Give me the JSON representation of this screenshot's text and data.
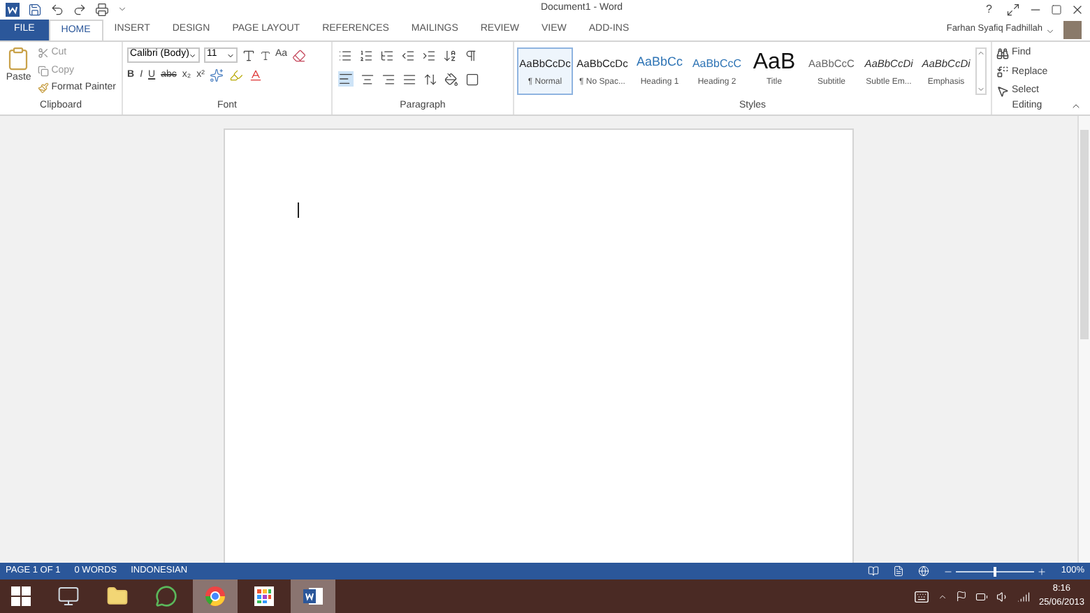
{
  "title_bar": {
    "title": "Document1 - Word",
    "help": "?",
    "user": "Farhan Syafiq Fadhillah"
  },
  "tabs": [
    {
      "label": "FILE",
      "kind": "file",
      "selected": false
    },
    {
      "label": "HOME",
      "kind": "tab",
      "selected": true
    },
    {
      "label": "INSERT",
      "kind": "tab",
      "selected": false
    },
    {
      "label": "DESIGN",
      "kind": "tab",
      "selected": false
    },
    {
      "label": "PAGE LAYOUT",
      "kind": "tab",
      "selected": false
    },
    {
      "label": "REFERENCES",
      "kind": "tab",
      "selected": false
    },
    {
      "label": "MAILINGS",
      "kind": "tab",
      "selected": false
    },
    {
      "label": "REVIEW",
      "kind": "tab",
      "selected": false
    },
    {
      "label": "VIEW",
      "kind": "tab",
      "selected": false
    },
    {
      "label": "ADD-INS",
      "kind": "tab",
      "selected": false
    }
  ],
  "clipboard": {
    "paste": "Paste",
    "cut": "Cut",
    "copy": "Copy",
    "format_painter": "Format Painter",
    "label": "Clipboard"
  },
  "font": {
    "family": "Calibri (Body)",
    "size": "11",
    "change_case": "Aa",
    "format_buttons": [
      "B",
      "I",
      "U",
      "abc",
      "x₂",
      "x²"
    ],
    "label": "Font"
  },
  "paragraph": {
    "label": "Paragraph"
  },
  "styles": {
    "label": "Styles",
    "items": [
      {
        "preview": "AaBbCcDc",
        "name": "¶ Normal",
        "kind": "normal",
        "selected": true
      },
      {
        "preview": "AaBbCcDc",
        "name": "¶ No Spac...",
        "kind": "normal",
        "selected": false
      },
      {
        "preview": "AaBbCc",
        "name": "Heading 1",
        "kind": "heading1",
        "selected": false
      },
      {
        "preview": "AaBbCcC",
        "name": "Heading 2",
        "kind": "heading2",
        "selected": false
      },
      {
        "preview": "AaB",
        "name": "Title",
        "kind": "title",
        "selected": false
      },
      {
        "preview": "AaBbCcC",
        "name": "Subtitle",
        "kind": "subtitle",
        "selected": false
      },
      {
        "preview": "AaBbCcDi",
        "name": "Subtle Em...",
        "kind": "emphasis",
        "selected": false
      },
      {
        "preview": "AaBbCcDi",
        "name": "Emphasis",
        "kind": "emphasis",
        "selected": false
      }
    ]
  },
  "editing": {
    "find": "Find",
    "replace": "Replace",
    "select": "Select",
    "label": "Editing"
  },
  "status_bar": {
    "page": "PAGE 1 OF 1",
    "words": "0 WORDS",
    "language": "INDONESIAN",
    "zoom": {
      "level": 0.5,
      "reading": "100%"
    }
  },
  "taskbar": {
    "apps": [
      {
        "kind": "explorer",
        "selected": false
      },
      {
        "kind": "folder",
        "selected": false
      },
      {
        "kind": "messenger",
        "selected": false
      },
      {
        "kind": "browser",
        "selected": true
      },
      {
        "kind": "tiles",
        "selected": false
      },
      {
        "kind": "word",
        "selected": true
      }
    ],
    "time": "8:16",
    "date": "25/06/2013"
  }
}
